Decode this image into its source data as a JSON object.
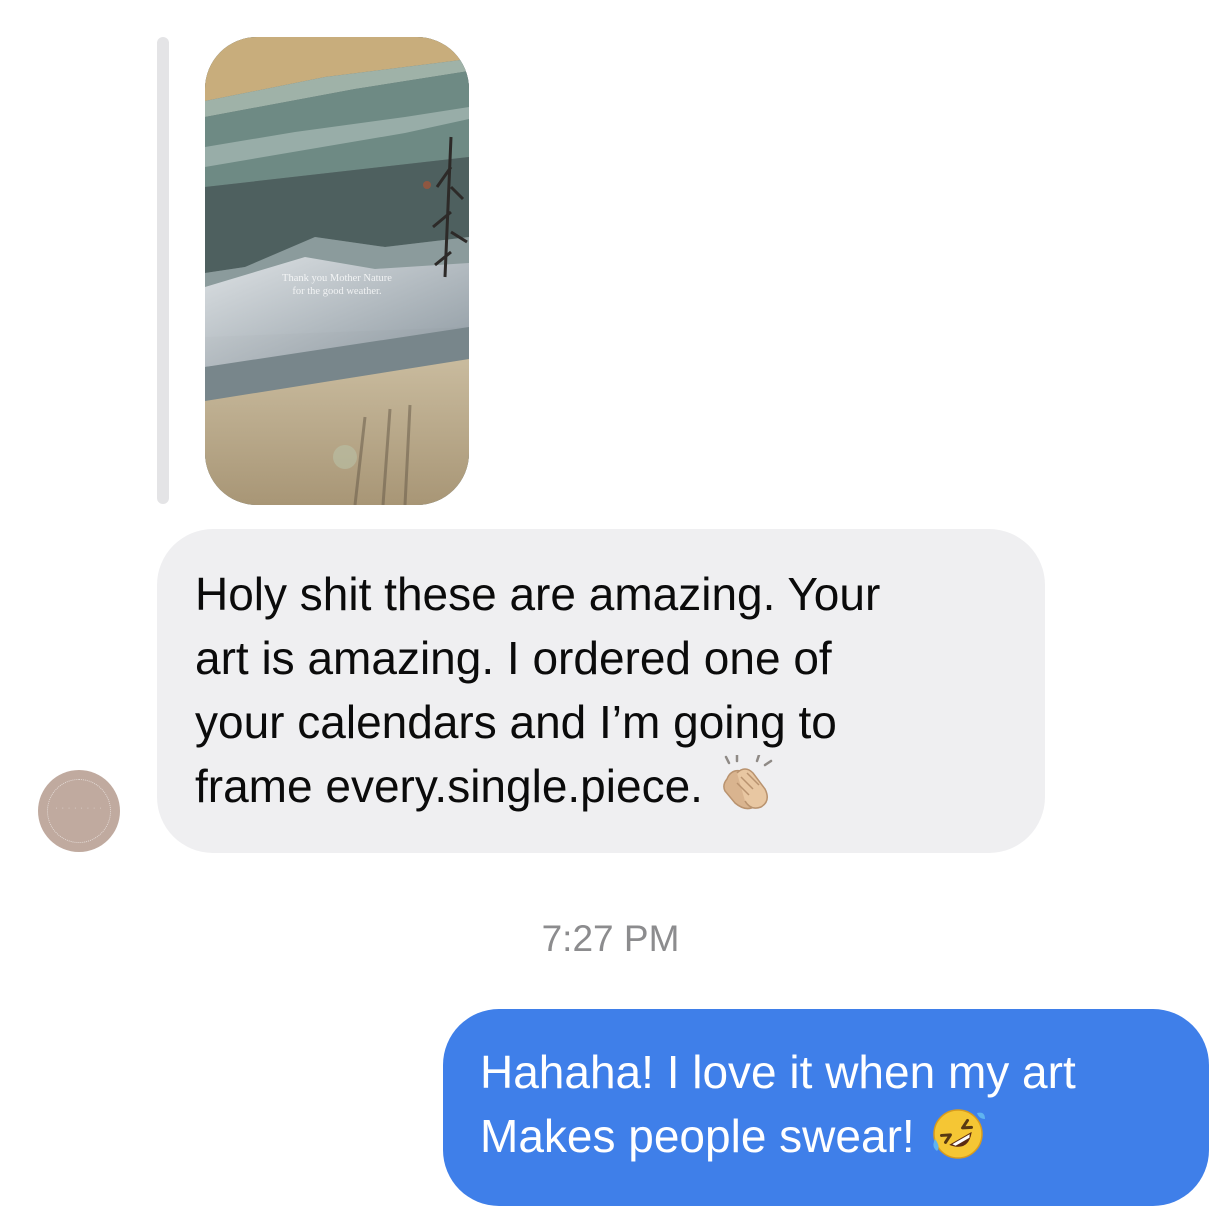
{
  "thread": {
    "story_reply": {
      "caption_line1": "Thank you Mother Nature",
      "caption_line2": "for the good weather."
    },
    "incoming": {
      "lines": [
        "Holy shit these are amazing. Your",
        "art is amazing. I ordered one of",
        "your calendars and I’m going to",
        "frame every.single.piece."
      ],
      "emoji": "clapping-hands"
    },
    "timestamp": "7:27 PM",
    "outgoing": {
      "lines": [
        "Hahaha! I love it when my art",
        "Makes people swear!"
      ],
      "emoji": "rolling-on-floor-laughing"
    }
  },
  "colors": {
    "incoming_bubble": "#efeff1",
    "outgoing_bubble": "#3f7fe9",
    "timestamp_text": "#8c8c8e",
    "reply_bar": "#e4e4e6",
    "avatar": "#c0aa9f"
  }
}
